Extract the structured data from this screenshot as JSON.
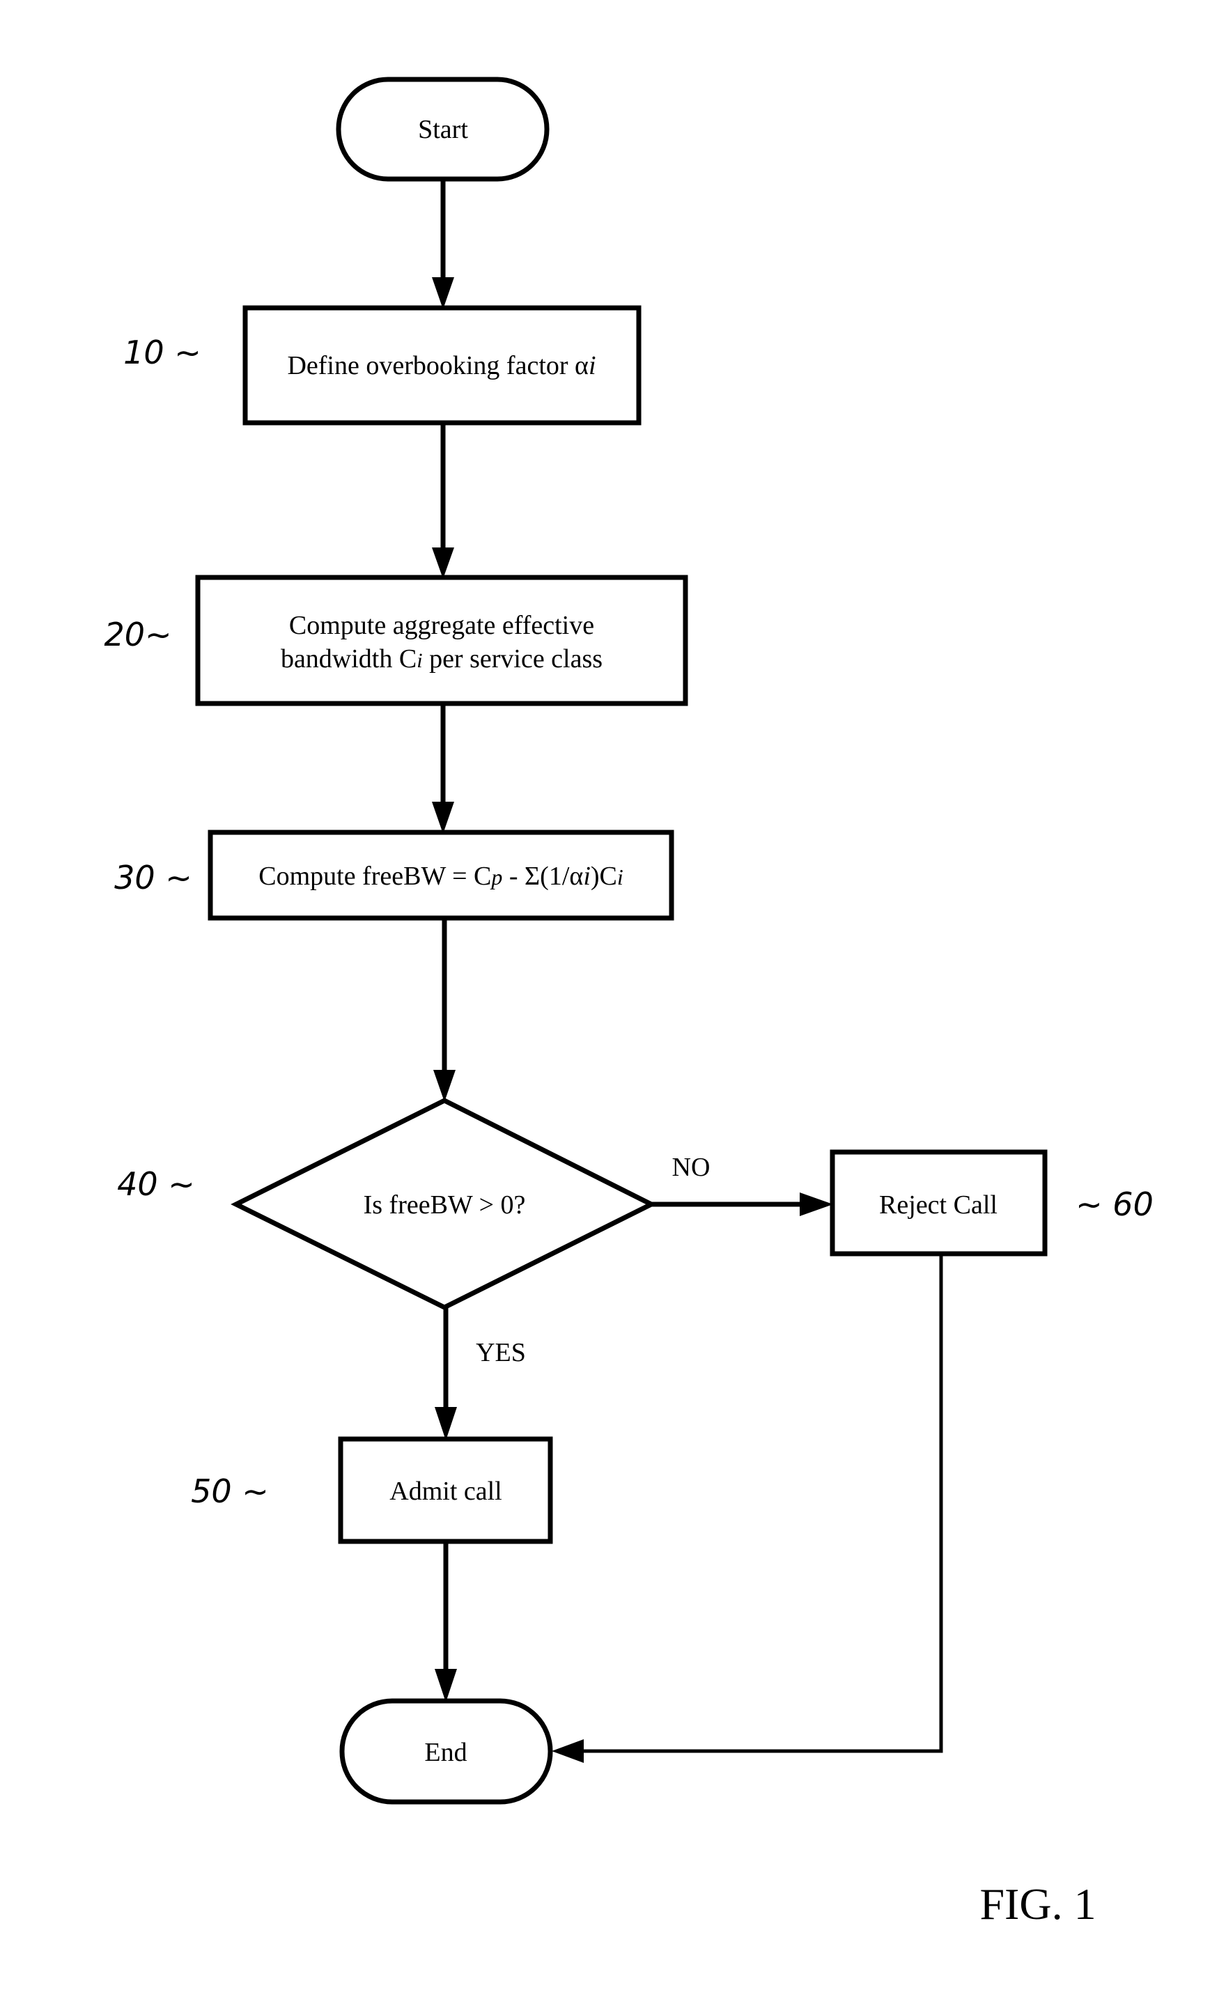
{
  "figure_label": "FIG. 1",
  "nodes": {
    "start": {
      "label": "Start",
      "shape": "terminator"
    },
    "step10": {
      "label": "Define overbooking factor α",
      "label_sub": "i",
      "ref": "10",
      "shape": "process"
    },
    "step20": {
      "line1": "Compute aggregate effective",
      "line2_a": "bandwidth C",
      "line2_sub": "i",
      "line2_b": " per service class",
      "ref": "20",
      "shape": "process"
    },
    "step30": {
      "text_a": "Compute freeBW = C",
      "sub_p": "p",
      "text_b": " - Σ(1/α",
      "sub_i1": "i",
      "text_c": ")C",
      "sub_i2": "i",
      "ref": "30",
      "shape": "process"
    },
    "step40": {
      "label": "Is freeBW > 0?",
      "ref": "40",
      "shape": "decision"
    },
    "step50": {
      "label": "Admit call",
      "ref": "50",
      "shape": "process"
    },
    "step60": {
      "label": "Reject Call",
      "ref": "60",
      "shape": "process"
    },
    "end": {
      "label": "End",
      "shape": "terminator"
    }
  },
  "edges": [
    {
      "from": "start",
      "to": "step10",
      "label": ""
    },
    {
      "from": "step10",
      "to": "step20",
      "label": ""
    },
    {
      "from": "step20",
      "to": "step30",
      "label": ""
    },
    {
      "from": "step30",
      "to": "step40",
      "label": ""
    },
    {
      "from": "step40",
      "to": "step60",
      "label": "NO"
    },
    {
      "from": "step40",
      "to": "step50",
      "label": "YES"
    },
    {
      "from": "step50",
      "to": "end",
      "label": ""
    },
    {
      "from": "step60",
      "to": "end",
      "label": ""
    }
  ],
  "refs": {
    "r10": "10 ~",
    "r20": "20~",
    "r30": "30 ~",
    "r40": "40 ~",
    "r50": "50 ~",
    "r60": "~ 60"
  },
  "edge_labels": {
    "no": "NO",
    "yes": "YES"
  }
}
